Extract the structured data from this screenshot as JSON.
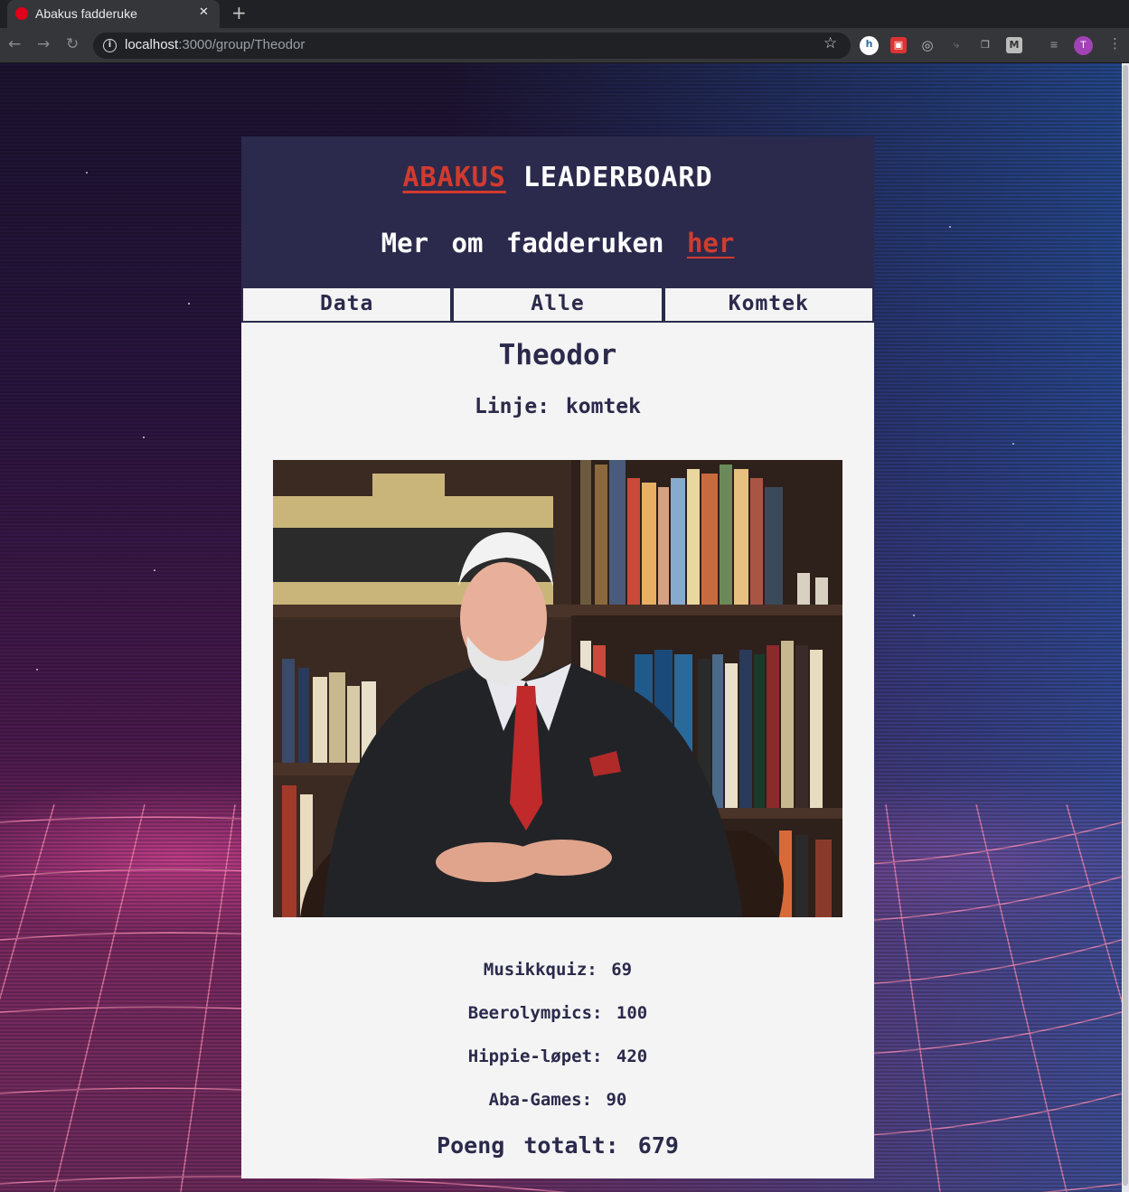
{
  "browser": {
    "tab_title": "Abakus fadderuke",
    "url_host": "localhost",
    "url_rest": ":3000/group/Theodor",
    "profile_initial": "T"
  },
  "header": {
    "brand": "ABAKUS",
    "title": "LEADERBOARD",
    "subtitle_prefix": "Mer om fadderuken",
    "subtitle_link": "her"
  },
  "tabs": [
    {
      "label": "Data"
    },
    {
      "label": "Alle"
    },
    {
      "label": "Komtek"
    }
  ],
  "group": {
    "name": "Theodor",
    "linje": "Linje: komtek"
  },
  "scores": [
    {
      "text": "Musikkquiz: 69"
    },
    {
      "text": "Beerolympics: 100"
    },
    {
      "text": "Hippie-løpet: 420"
    },
    {
      "text": "Aba-Games: 90"
    }
  ],
  "total": "Poeng totalt: 679",
  "colors": {
    "header_bg": "#2b2a4c",
    "accent": "#d23b2e",
    "content_bg": "#f4f4f4"
  }
}
